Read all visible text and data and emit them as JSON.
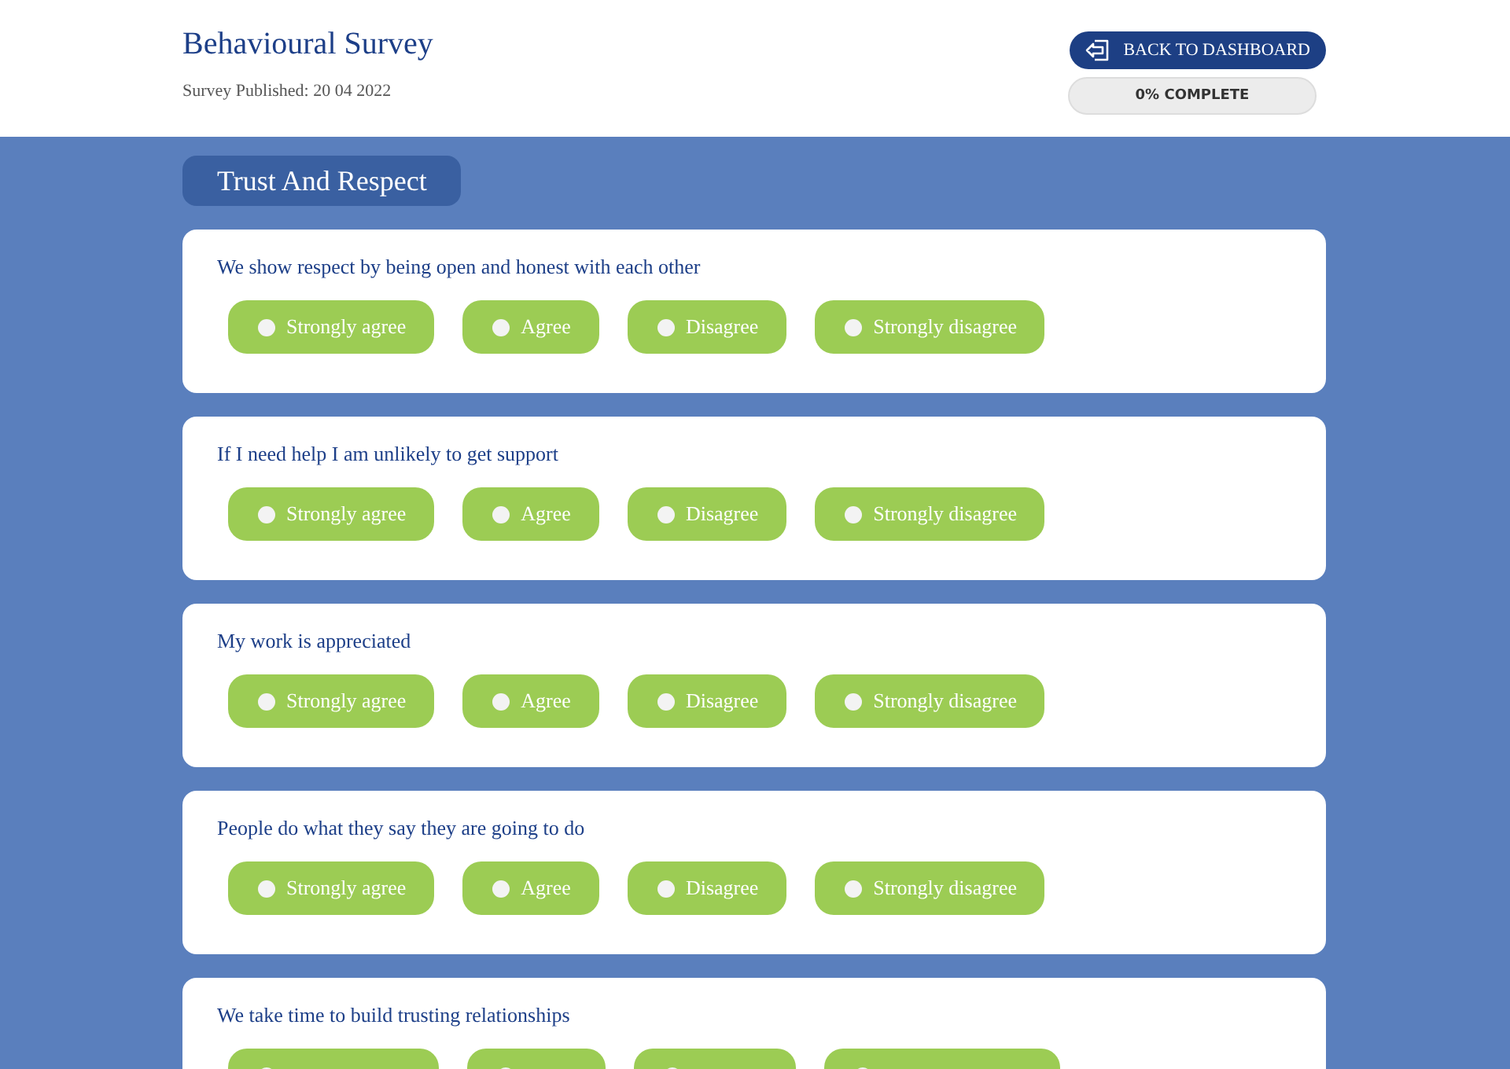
{
  "header": {
    "title": "Behavioural Survey",
    "published": "Survey Published: 20 04 2022",
    "back_button": "BACK TO DASHBOARD",
    "progress": {
      "label": "0% COMPLETE"
    }
  },
  "section": {
    "title": "Trust And Respect"
  },
  "questions": [
    {
      "text": "We show respect by being open and honest with each other",
      "options": [
        {
          "label": "Strongly agree",
          "selected": false
        },
        {
          "label": "Agree",
          "selected": false
        },
        {
          "label": "Disagree",
          "selected": false
        },
        {
          "label": "Strongly disagree",
          "selected": false
        }
      ]
    },
    {
      "text": "If I need help I am unlikely to get support",
      "options": [
        {
          "label": "Strongly agree",
          "selected": false
        },
        {
          "label": "Agree",
          "selected": false
        },
        {
          "label": "Disagree",
          "selected": false
        },
        {
          "label": "Strongly disagree",
          "selected": false
        }
      ]
    },
    {
      "text": "My work is appreciated",
      "options": [
        {
          "label": "Strongly agree",
          "selected": false
        },
        {
          "label": "Agree",
          "selected": false
        },
        {
          "label": "Disagree",
          "selected": false
        },
        {
          "label": "Strongly disagree",
          "selected": false
        }
      ]
    },
    {
      "text": "People do what they say they are going to do",
      "options": [
        {
          "label": "Strongly agree",
          "selected": false
        },
        {
          "label": "Agree",
          "selected": false
        },
        {
          "label": "Disagree",
          "selected": false
        },
        {
          "label": "Strongly disagree",
          "selected": false
        }
      ]
    },
    {
      "text": "We take time to build trusting relationships",
      "options": [
        {
          "selected": false
        },
        {
          "selected": false
        },
        {
          "selected": false
        },
        {
          "selected": false
        }
      ]
    }
  ]
}
